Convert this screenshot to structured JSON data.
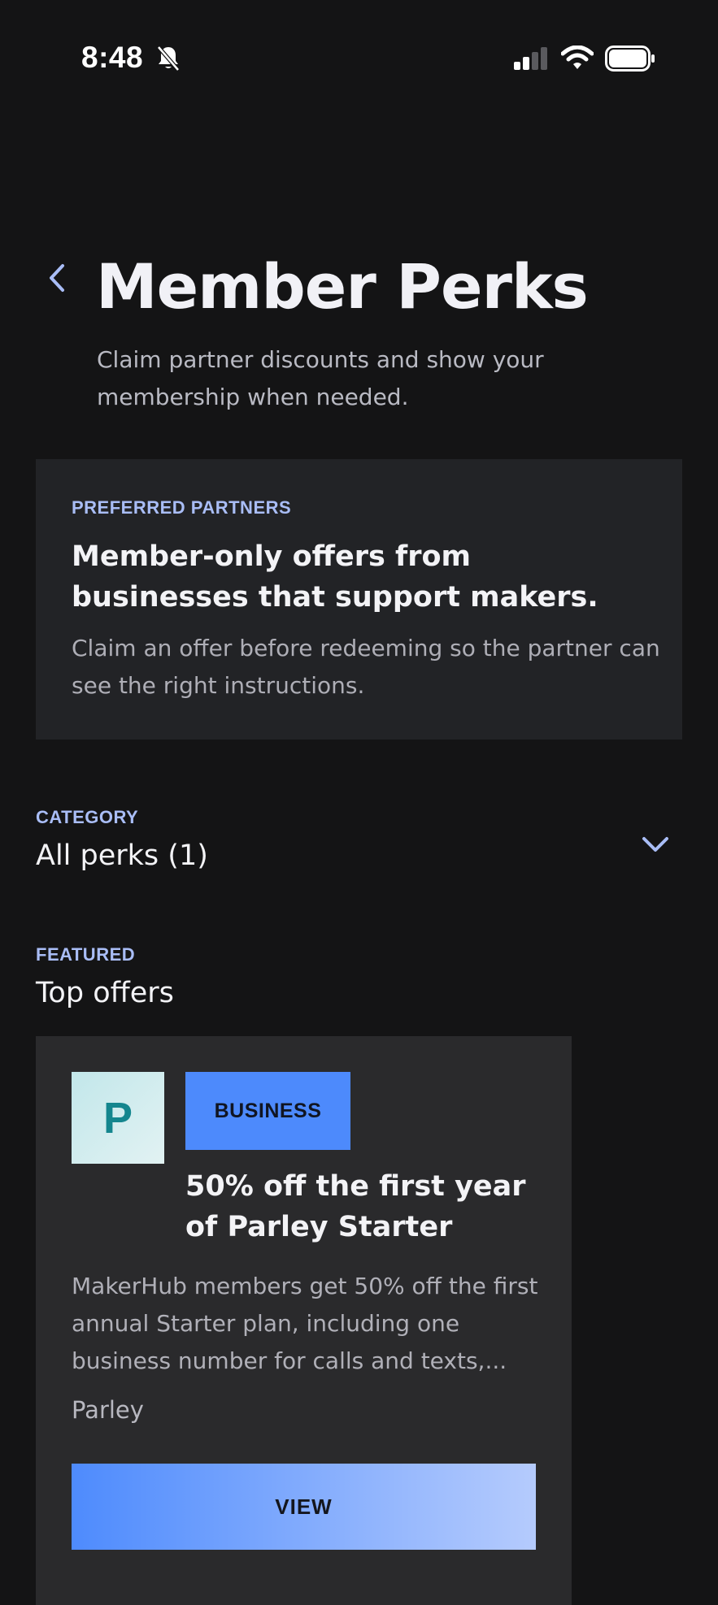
{
  "status_bar": {
    "time": "8:48",
    "icons": [
      "bell-slash-icon",
      "cellular-signal-icon",
      "wifi-icon",
      "battery-icon"
    ]
  },
  "header": {
    "back_icon": "chevron-left-icon",
    "title": "Member Perks",
    "subtitle": "Claim partner discounts and show your membership when needed."
  },
  "partners_card": {
    "eyebrow": "PREFERRED PARTNERS",
    "heading": "Member-only offers from businesses that support makers.",
    "body": "Claim an offer before redeeming so the partner can see the right instructions."
  },
  "category": {
    "label": "CATEGORY",
    "selected": "All perks (1)",
    "icon": "chevron-down-icon"
  },
  "featured": {
    "eyebrow": "FEATURED",
    "heading": "Top offers"
  },
  "offers": [
    {
      "logo_letter": "P",
      "badge": "BUSINESS",
      "title": "50% off the first year of Parley Starter",
      "description": "MakerHub members get 50% off the first annual Starter plan, including one business number for calls and texts,...",
      "partner": "Parley",
      "cta_label": "VIEW"
    }
  ],
  "colors": {
    "background": "#141415",
    "card": "#222326",
    "offer_card": "#2a2a2c",
    "accent": "#a9bdf6",
    "badge": "#4d8afc",
    "button_start": "#4e8bfd",
    "button_end": "#b5cbfd"
  }
}
